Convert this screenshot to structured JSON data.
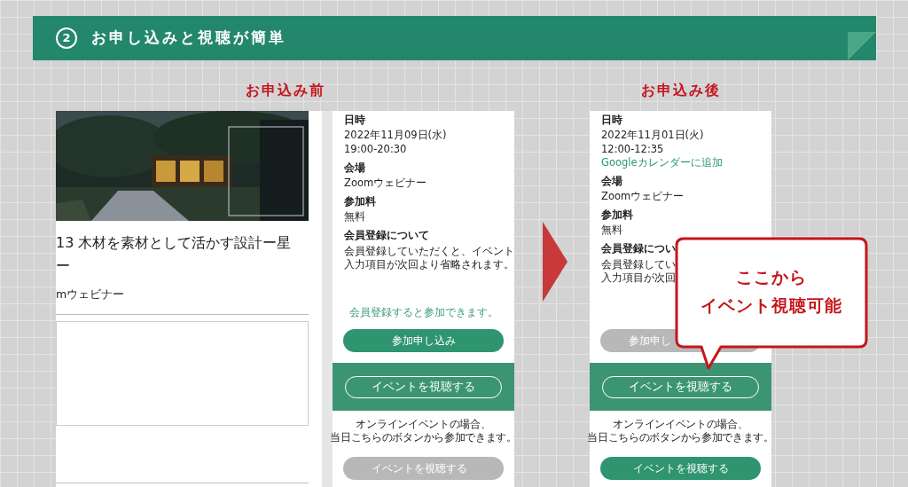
{
  "header": {
    "number": "2",
    "title": "お申し込みと視聴が簡単"
  },
  "before": {
    "label": "お申込み前",
    "page": {
      "title_lines": [
        "13 木材を素材として活かす設計ー星",
        "ー"
      ],
      "venue": "mウェビナー"
    },
    "info": [
      {
        "kind": "heading",
        "text": "日時"
      },
      {
        "kind": "text",
        "text": "2022年11月09日(水)"
      },
      {
        "kind": "text",
        "text": "19:00-20:30"
      },
      {
        "kind": "heading",
        "text": "会場"
      },
      {
        "kind": "text",
        "text": "Zoomウェビナー"
      },
      {
        "kind": "heading",
        "text": "参加料"
      },
      {
        "kind": "text",
        "text": "無料"
      },
      {
        "kind": "heading",
        "text": "会員登録について"
      },
      {
        "kind": "paragraph",
        "lines": [
          "会員登録していただくと、イベント",
          "入力項目が次回より省略されます。"
        ]
      }
    ],
    "actions": [
      {
        "kind": "note",
        "text": "会員登録すると参加できます。"
      },
      {
        "kind": "button",
        "text": "参加申し込み",
        "disabled": false
      },
      {
        "kind": "watch_section",
        "text": "イベントを視聴する"
      },
      {
        "kind": "caption",
        "lines": [
          "オンラインイベントの場合、",
          "当日こちらのボタンから参加できます。"
        ]
      },
      {
        "kind": "button",
        "text": "イベントを視聴する",
        "disabled": true
      }
    ]
  },
  "after": {
    "label": "お申込み後",
    "info": [
      {
        "kind": "heading",
        "text": "日時"
      },
      {
        "kind": "text",
        "text": "2022年11月01日(火)"
      },
      {
        "kind": "text",
        "text": "12:00-12:35"
      },
      {
        "kind": "link",
        "text": "Googleカレンダーに追加"
      },
      {
        "kind": "heading",
        "text": "会場"
      },
      {
        "kind": "text",
        "text": "Zoomウェビナー"
      },
      {
        "kind": "heading",
        "text": "参加料"
      },
      {
        "kind": "text",
        "text": "無料"
      },
      {
        "kind": "heading",
        "text": "会員登録につい"
      },
      {
        "kind": "paragraph",
        "lines": [
          "会員登録してい",
          "入力項目が次回"
        ]
      }
    ],
    "actions": [
      {
        "kind": "button",
        "text": "参加申し",
        "disabled": true
      },
      {
        "kind": "watch_section",
        "text": "イベントを視聴する"
      },
      {
        "kind": "caption",
        "lines": [
          "オンラインイベントの場合、",
          "当日こちらのボタンから参加できます。"
        ]
      },
      {
        "kind": "button",
        "text": "イベントを視聴する",
        "disabled": false
      }
    ]
  },
  "callout": {
    "lines": [
      "ここから",
      "イベント視聴可能"
    ]
  }
}
